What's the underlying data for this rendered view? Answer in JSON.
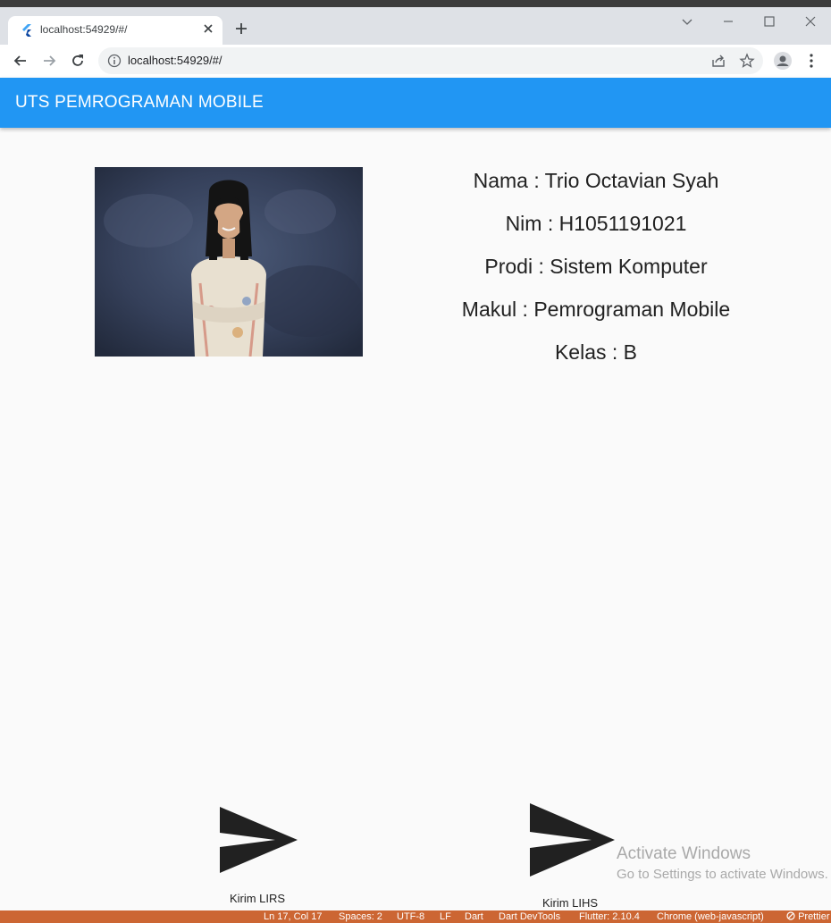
{
  "browser": {
    "tab_title": "localhost:54929/#/",
    "url": "localhost:54929/#/",
    "favicon": "flutter-icon"
  },
  "app": {
    "title": "UTS PEMROGRAMAN MOBILE",
    "accent_color": "#2196f3"
  },
  "profile": {
    "photo_icon": "profile-photo",
    "lines": [
      "Nama : Trio Octavian Syah",
      "Nim : H1051191021",
      "Prodi : Sistem Komputer",
      "Makul : Pemrograman Mobile",
      "Kelas : B"
    ]
  },
  "actions": [
    {
      "label": "Kirim LIRS",
      "icon": "send-icon"
    },
    {
      "label": "Kirim LIHS",
      "icon": "send-icon"
    }
  ],
  "watermark": {
    "line1": "Activate Windows",
    "line2": "Go to Settings to activate Windows."
  },
  "statusbar": {
    "color": "#cc6633",
    "items": [
      "Ln 17, Col 17",
      "Spaces: 2",
      "UTF-8",
      "LF",
      "Dart",
      "Dart DevTools",
      "Flutter: 2.10.4",
      "Chrome (web-javascript)",
      "Prettier"
    ]
  }
}
